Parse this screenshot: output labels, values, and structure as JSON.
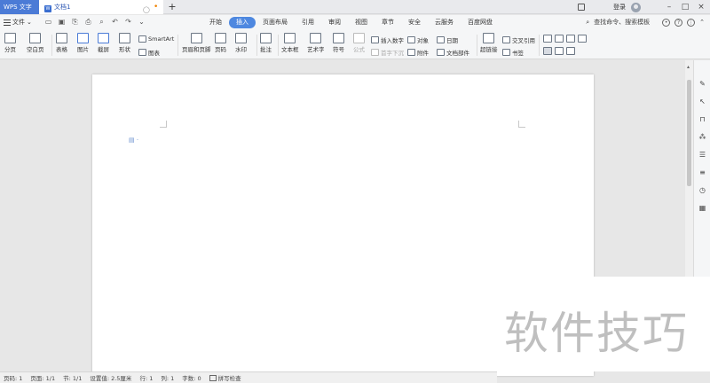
{
  "titlebar": {
    "app_name": "WPS 文字",
    "doc_tab": {
      "badge": "W",
      "title": "文档1"
    },
    "new_tab": "+",
    "login": "登录"
  },
  "menubar": {
    "file": "文件",
    "tabs": [
      "开始",
      "插入",
      "页面布局",
      "引用",
      "审阅",
      "视图",
      "章节",
      "安全",
      "云服务",
      "百度网盘"
    ],
    "active_tab": "插入",
    "search": "查找命令、搜索模板"
  },
  "ribbon": {
    "page_break": "分页",
    "blank_page": "空白页",
    "table": "表格",
    "picture": "图片",
    "screenshot": "截屏",
    "shape": "形状",
    "smartart": "SmartArt",
    "chart": "图表",
    "header_footer": "页眉和页脚",
    "page_number": "页码",
    "watermark": "水印",
    "comment": "批注",
    "textbox": "文本框",
    "wordart": "艺术字",
    "symbol": "符号",
    "formula": "公式",
    "insert_number": "插入数字",
    "first_letter_sink": "首字下沉",
    "object": "对象",
    "attachment": "附件",
    "date": "日期",
    "doc_parts": "文档部件",
    "hyperlink": "超链接",
    "cross_ref": "交叉引用",
    "bookmark": "书签"
  },
  "statusbar": {
    "page_no": "页码: 1",
    "pages": "页面: 1/1",
    "section": "节: 1/1",
    "setting": "设置值: 2.5厘米",
    "row": "行: 1",
    "col": "列: 1",
    "words": "字数: 0",
    "spellcheck": "拼写检查"
  },
  "watermark_overlay": "软件技巧"
}
